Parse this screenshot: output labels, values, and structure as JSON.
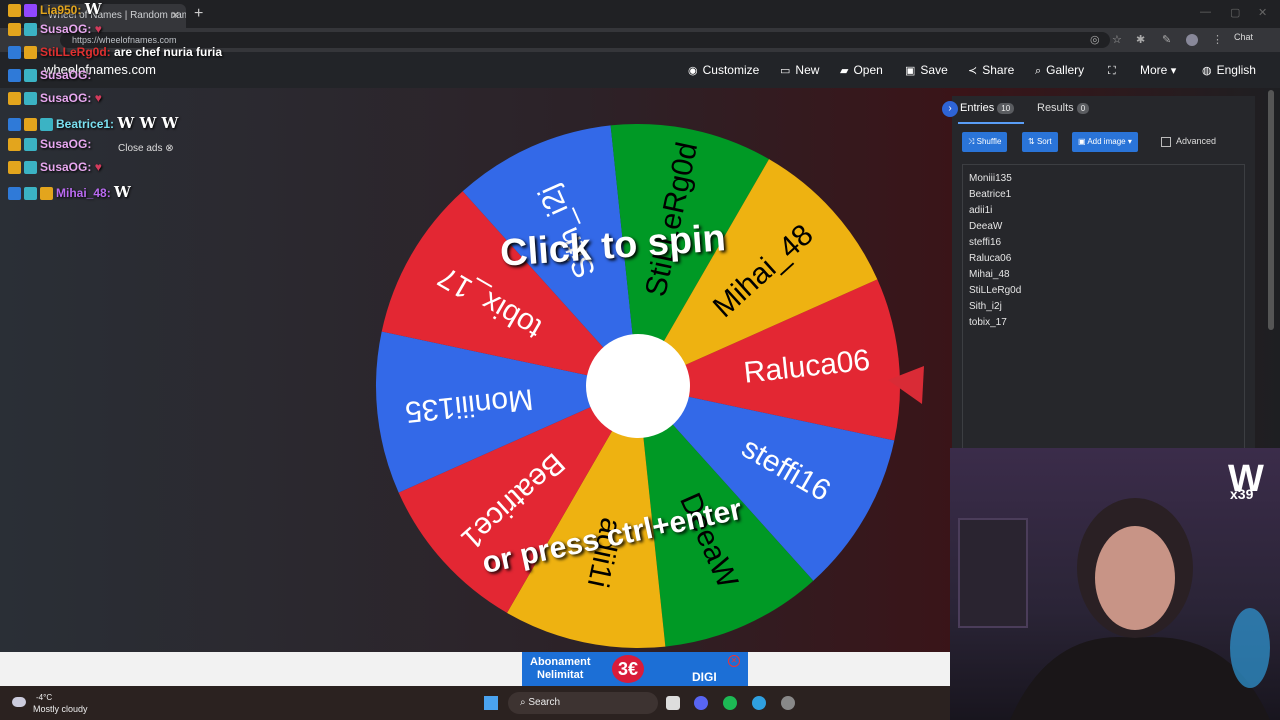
{
  "browser": {
    "tab_title": "Wheel of Names | Random name ...",
    "url": "https://wheelofnames.com",
    "chat_label": "Chat"
  },
  "site": {
    "title": "wheelofnames.com",
    "nav": [
      {
        "label": "Customize",
        "icon": "palette-icon"
      },
      {
        "label": "New",
        "icon": "file-icon"
      },
      {
        "label": "Open",
        "icon": "folder-icon"
      },
      {
        "label": "Save",
        "icon": "save-icon"
      },
      {
        "label": "Share",
        "icon": "share-icon"
      },
      {
        "label": "Gallery",
        "icon": "search-icon"
      },
      {
        "label": "",
        "icon": "fullscreen-icon"
      },
      {
        "label": "More",
        "icon": "chevron-down-icon"
      },
      {
        "label": "English",
        "icon": "globe-icon"
      }
    ]
  },
  "wheel": {
    "click_text": "Click to spin",
    "press_text": "or press ctrl+enter",
    "segments": [
      {
        "name": "Raluca06",
        "color": "#e32733"
      },
      {
        "name": "steffi16",
        "color": "#3369e8"
      },
      {
        "name": "DeeaW",
        "color": "#009925"
      },
      {
        "name": "adii1i",
        "color": "#eeb211"
      },
      {
        "name": "Beatrice1",
        "color": "#e32733"
      },
      {
        "name": "Moniii135",
        "color": "#3369e8"
      },
      {
        "name": "tobix_17",
        "color": "#e32733"
      },
      {
        "name": "Sith_i2j",
        "color": "#3369e8"
      },
      {
        "name": "StiLLeRg0d",
        "color": "#009925"
      },
      {
        "name": "Mihai_48",
        "color": "#eeb211"
      }
    ]
  },
  "panel": {
    "tabs": [
      {
        "label": "Entries",
        "count": "10"
      },
      {
        "label": "Results",
        "count": "0"
      }
    ],
    "buttons": {
      "shuffle": "Shuffle",
      "sort": "Sort",
      "add_image": "Add image"
    },
    "advanced_label": "Advanced",
    "entries": [
      "Moniii135",
      "Beatrice1",
      "adii1i",
      "DeeaW",
      "steffi16",
      "Raluca06",
      "Mihai_48",
      "StiLLeRg0d",
      "Sith_i2j",
      "tobix_17"
    ]
  },
  "chat": [
    {
      "user": "Lia950:",
      "color": "#e3a51d",
      "msg": "W"
    },
    {
      "user": "SusaOG:",
      "color": "#e8a8f0",
      "msg": ""
    },
    {
      "user": "StiLLeRg0d:",
      "color": "#e03030",
      "msg": "are chef nuria furia"
    },
    {
      "user": "SusaOG:",
      "color": "#e8a8f0",
      "msg": ""
    },
    {
      "user": "SusaOG:",
      "color": "#e8a8f0",
      "msg": ""
    },
    {
      "user": "Beatrice1:",
      "color": "#7ae0f0",
      "msg": "W W W"
    },
    {
      "user": "SusaOG:",
      "color": "#e8a8f0",
      "msg": ""
    },
    {
      "user": "SusaOG:",
      "color": "#e8a8f0",
      "msg": ""
    },
    {
      "user": "Mihai_48:",
      "color": "#b96af0",
      "msg": "W"
    }
  ],
  "close_ads": "Close ads",
  "webcam": {
    "badge": "W",
    "multiplier": "x39"
  },
  "ad": {
    "line1": "Abonament",
    "line2": "Nelimitat",
    "price": "3€",
    "brand": "DIGI"
  },
  "taskbar": {
    "temp": "-4°C",
    "condition": "Mostly cloudy",
    "search": "Search"
  }
}
